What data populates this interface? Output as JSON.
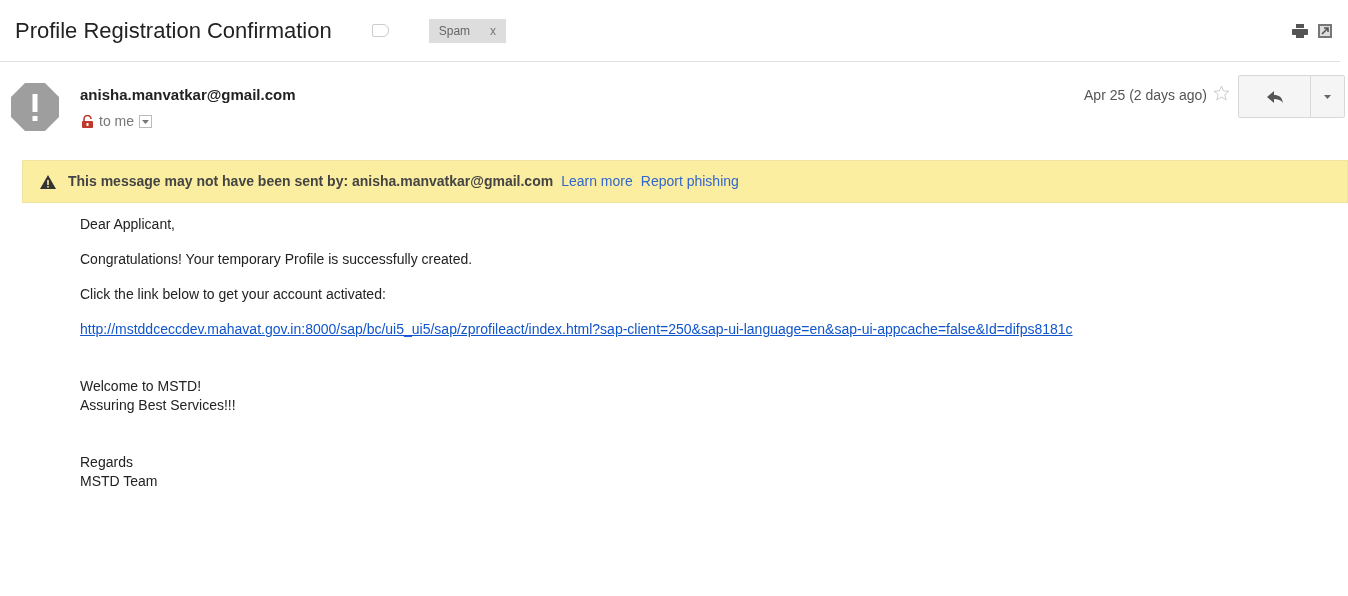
{
  "subject": "Profile Registration Confirmation",
  "labels": [
    {
      "text": "Spam",
      "remove": "x"
    }
  ],
  "message": {
    "sender": "anisha.manvatkar@gmail.com",
    "recipient": "to me",
    "date": "Apr 25 (2 days ago)",
    "starred": false
  },
  "warning": {
    "text": "This message may not have been sent by: anisha.manvatkar@gmail.com",
    "links": [
      "Learn more",
      "Report phishing"
    ]
  },
  "body": [
    {
      "kind": "text",
      "lines": [
        "Dear Applicant,"
      ]
    },
    {
      "kind": "text",
      "lines": [
        "Congratulations! Your temporary Profile is successfully created."
      ]
    },
    {
      "kind": "text",
      "lines": [
        "Click the link below to get your account activated:"
      ]
    },
    {
      "kind": "link",
      "text": "http://mstddceccdev.mahavat.gov.in:8000/sap/bc/ui5_ui5/sap/zprofileact/index.html?sap-client=250&sap-ui-language=en&sap-ui-appcache=false&Id=difps8181c"
    },
    {
      "kind": "text",
      "lines": [
        "Welcome to MSTD!",
        "Assuring Best Services!!!"
      ]
    },
    {
      "kind": "text",
      "lines": [
        "Regards",
        "MSTD Team"
      ]
    }
  ]
}
